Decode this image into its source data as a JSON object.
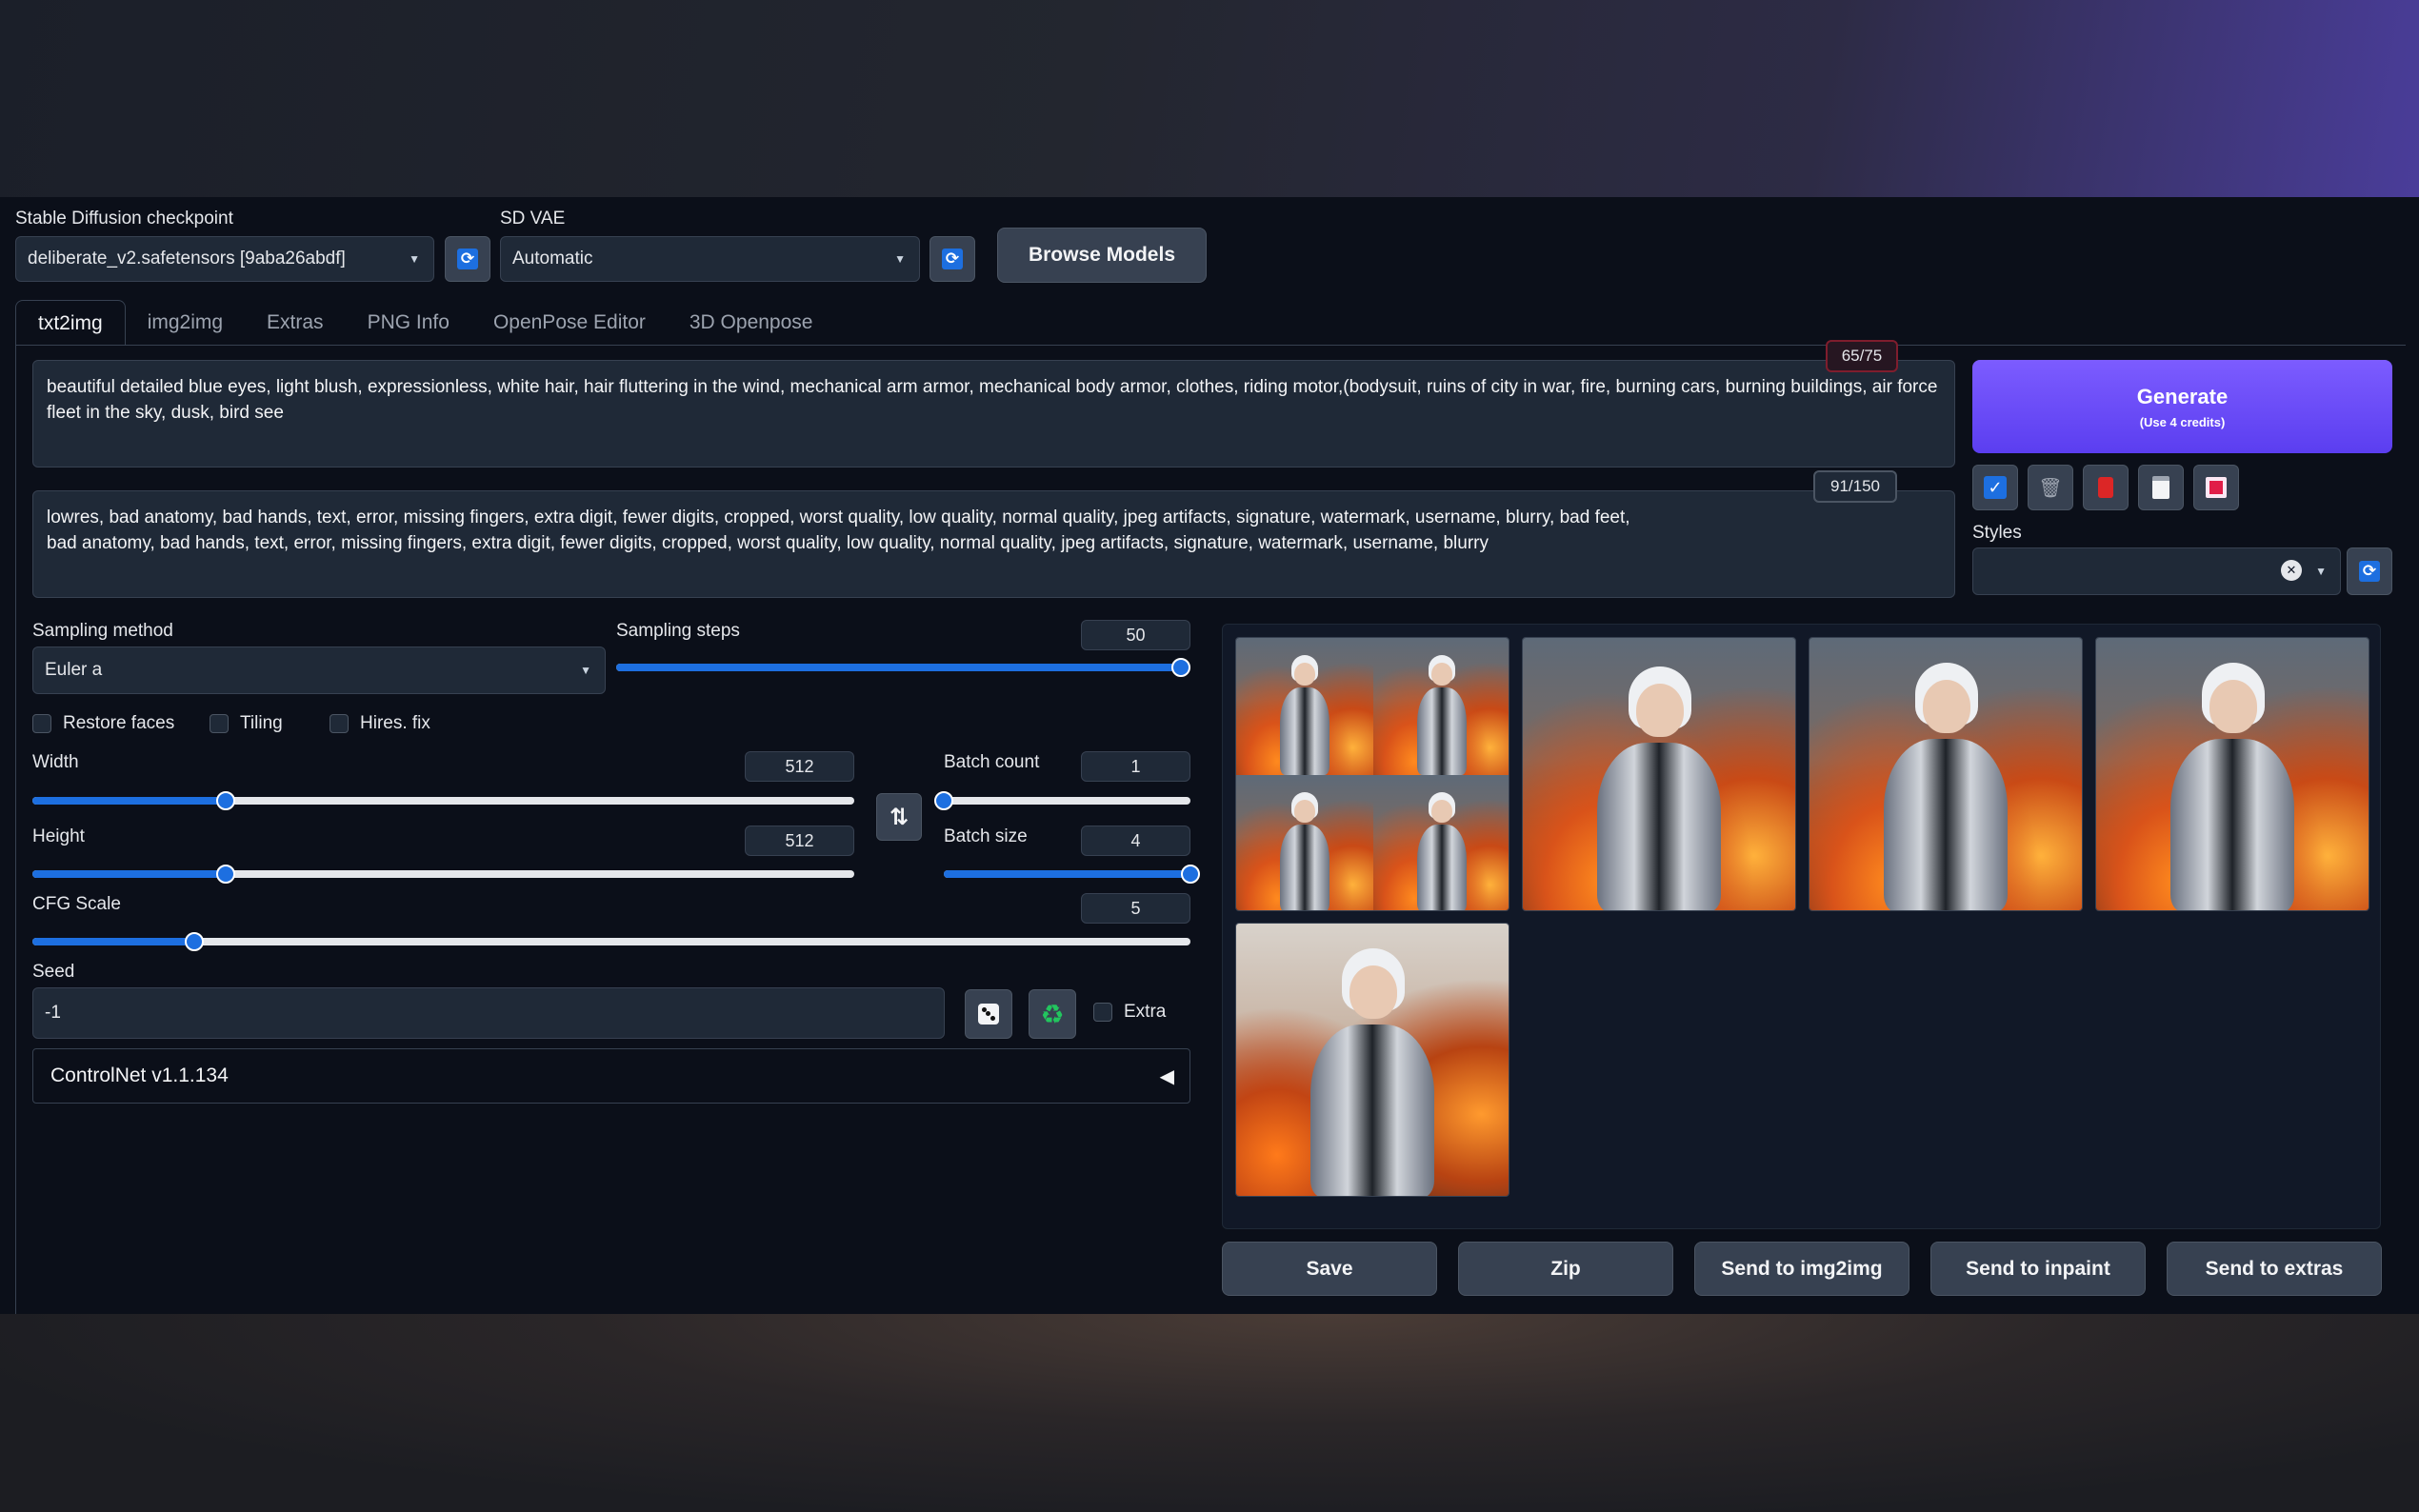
{
  "checkpoint": {
    "label": "Stable Diffusion checkpoint",
    "value": "deliberate_v2.safetensors [9aba26abdf]"
  },
  "vae": {
    "label": "SD VAE",
    "value": "Automatic"
  },
  "browse_models": "Browse Models",
  "tabs": [
    {
      "label": "txt2img"
    },
    {
      "label": "img2img"
    },
    {
      "label": "Extras"
    },
    {
      "label": "PNG Info"
    },
    {
      "label": "OpenPose Editor"
    },
    {
      "label": "3D Openpose"
    }
  ],
  "prompt": {
    "text": "beautiful detailed blue eyes, light blush, expressionless, white hair, hair fluttering in the wind, mechanical arm armor, mechanical body armor, clothes, riding motor,(bodysuit, ruins of city in war, fire, burning cars, burning buildings, air force fleet in the sky, dusk, bird see",
    "counter": "65/75"
  },
  "negative_prompt": {
    "line1": "lowres, bad anatomy, bad hands, text, error, missing fingers, extra digit, fewer digits, cropped, worst quality, low quality, normal quality, jpeg artifacts, signature, watermark, username, blurry, bad feet,",
    "line2": "bad anatomy, bad hands, text, error, missing fingers, extra digit, fewer digits, cropped, worst quality, low quality, normal quality, jpeg artifacts, signature, watermark, username, blurry",
    "counter": "91/150"
  },
  "generate": {
    "label": "Generate",
    "sublabel": "(Use 4 credits)"
  },
  "styles": {
    "label": "Styles",
    "clear": "✕"
  },
  "sampling_method": {
    "label": "Sampling method",
    "value": "Euler a"
  },
  "sampling_steps": {
    "label": "Sampling steps",
    "value": "50",
    "fraction": 1.0
  },
  "options": {
    "restore_faces": "Restore faces",
    "tiling": "Tiling",
    "hires_fix": "Hires. fix"
  },
  "width": {
    "label": "Width",
    "value": "512",
    "fraction": 0.235
  },
  "height": {
    "label": "Height",
    "value": "512",
    "fraction": 0.235
  },
  "swap_icon": "⇅",
  "batch_count": {
    "label": "Batch count",
    "value": "1",
    "fraction": 0.0
  },
  "batch_size": {
    "label": "Batch size",
    "value": "4",
    "fraction": 1.0
  },
  "cfg_scale": {
    "label": "CFG Scale",
    "value": "5",
    "fraction": 0.14
  },
  "seed": {
    "label": "Seed",
    "value": "-1",
    "extra": "Extra"
  },
  "controlnet": {
    "label": "ControlNet v1.1.134",
    "toggle": "◀"
  },
  "actions": [
    "Save",
    "Zip",
    "Send to img2img",
    "Send to inpaint",
    "Send to extras"
  ],
  "colors": {
    "accent": "#1d6fe0",
    "generate": "#6d4cff",
    "counter_warn": "#7f1d2d"
  }
}
